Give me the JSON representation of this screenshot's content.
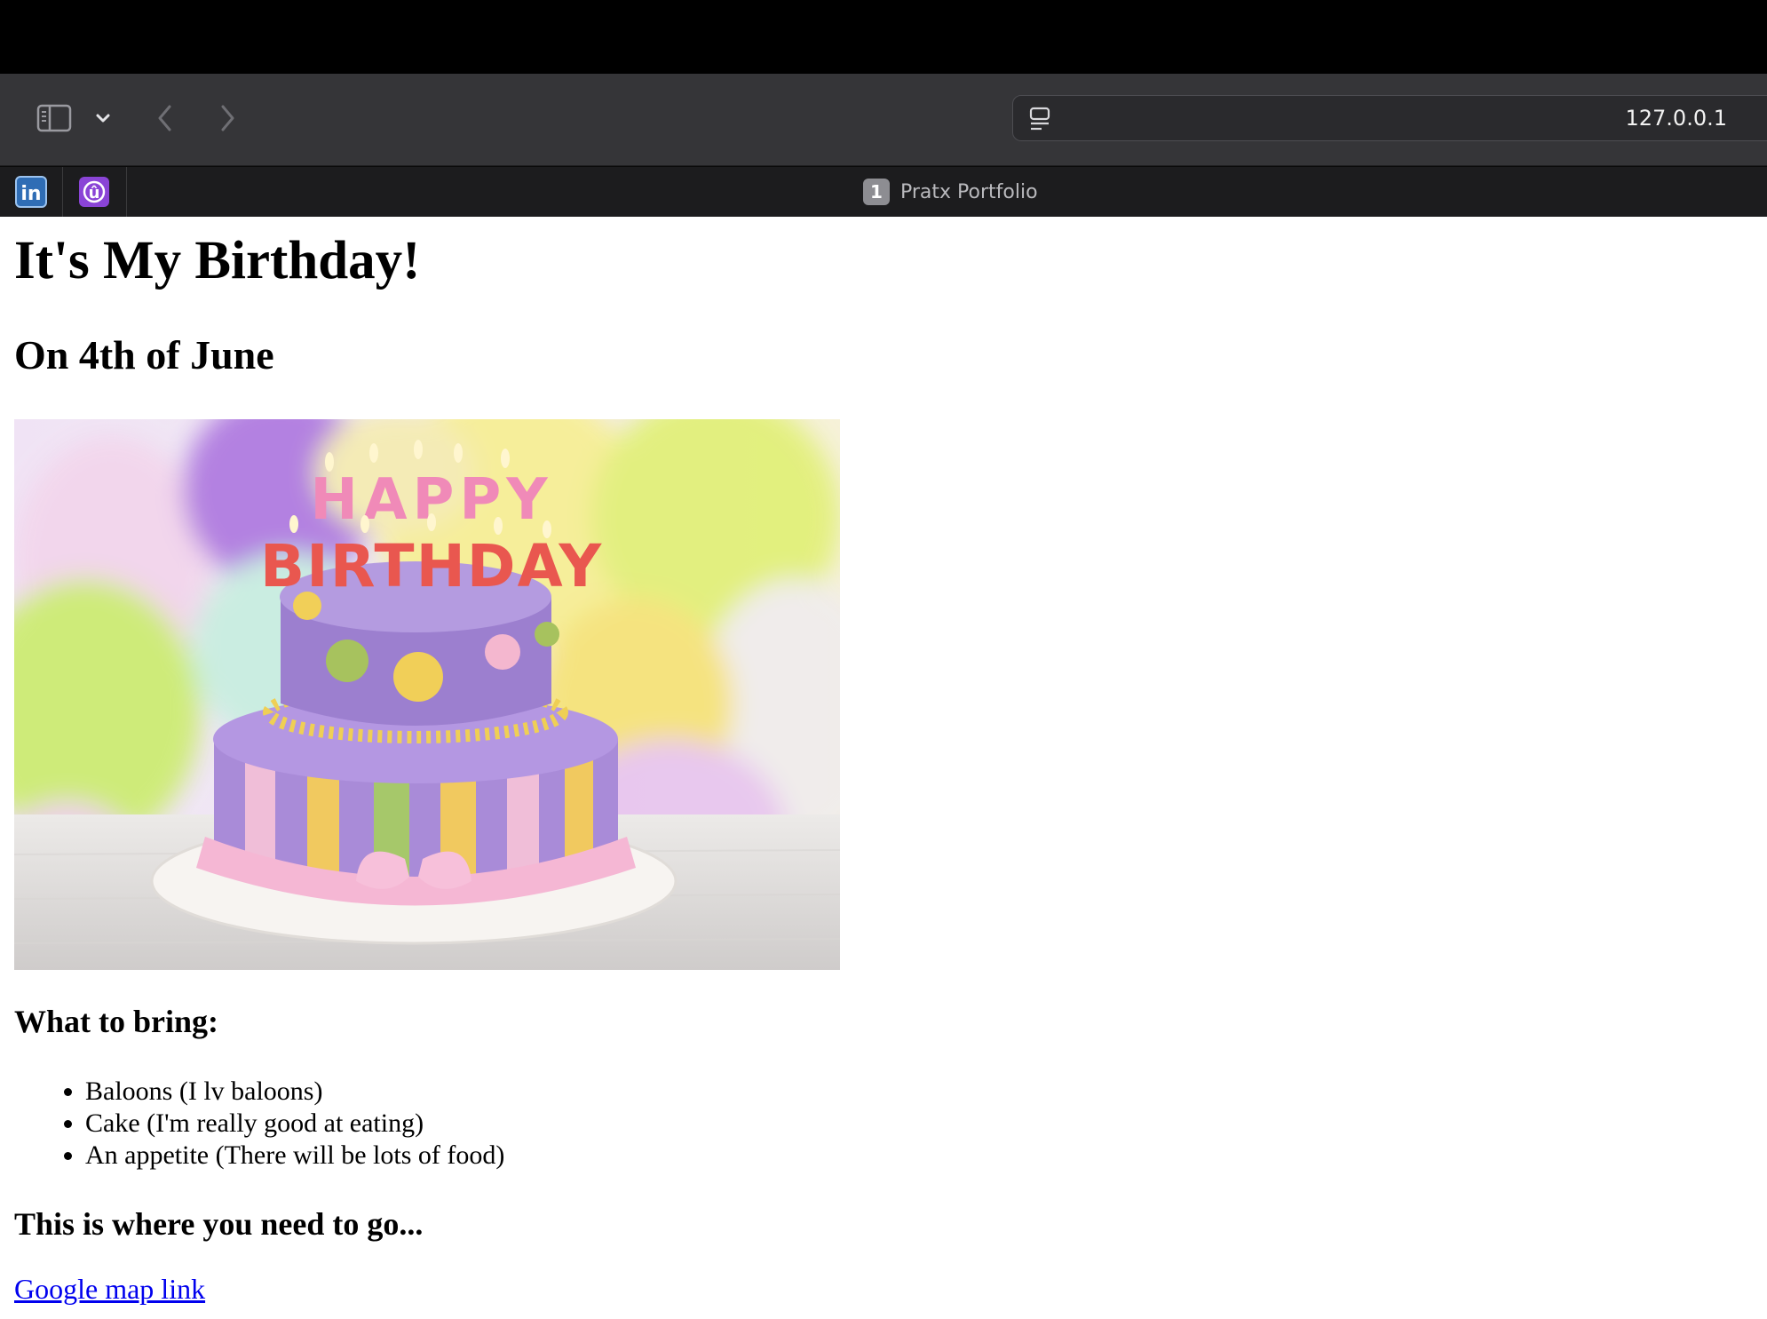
{
  "browser": {
    "url": "127.0.0.1",
    "tab": {
      "index": "1",
      "title": "Pratx Portfolio"
    },
    "pinned_tabs": [
      {
        "icon": "linkedin-icon",
        "label": "in"
      },
      {
        "icon": "ublock-icon",
        "label": "û"
      }
    ]
  },
  "page": {
    "title": "It's My Birthday!",
    "date": "On 4th of June",
    "image": {
      "candles_line1": "HAPPY",
      "candles_line2": "BIRTHDAY"
    },
    "bring_heading": "What to bring:",
    "bring_items": [
      "Baloons (I lv baloons)",
      "Cake (I'm really good at eating)",
      "An appetite (There will be lots of food)"
    ],
    "go_heading": "This is where you need to go...",
    "map_link": "Google map link"
  },
  "colors": {
    "link": "#0000ee",
    "toolbar": "#353538",
    "tabbar": "#1c1c1e"
  }
}
